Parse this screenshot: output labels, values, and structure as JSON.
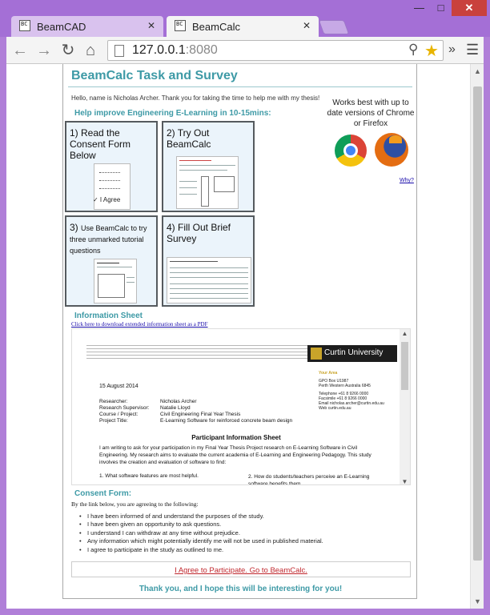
{
  "browser": {
    "tabs": [
      {
        "label": "BeamCAD",
        "favicon": "BC"
      },
      {
        "label": "BeamCalc",
        "favicon": "BC"
      }
    ],
    "url_host": "127.0.0.1",
    "url_port": ":8080"
  },
  "page": {
    "title": "BeamCalc Task and Survey",
    "greeting": "Hello, name is Nicholas Archer. Thank you for taking the time to help me with my thesis!",
    "help_heading": "Help improve Engineering E-Learning in 10-15mins:",
    "steps": [
      {
        "title": "1) Read the Consent Form Below",
        "thumb_text": "✓ I Agree"
      },
      {
        "title": "2) Try Out BeamCalc"
      },
      {
        "title_num": "3)",
        "title_rest": "Use BeamCalc to try three unmarked tutorial questions"
      },
      {
        "title": "4) Fill Out Brief Survey"
      }
    ],
    "browser_note": "Works best with up to date versions of Chrome or Firefox",
    "why_link": "Why?",
    "info_heading": "Information Sheet",
    "pdf_link": "Click here to download extended information sheet as a PDF",
    "pdf": {
      "university": "Curtin University",
      "date": "15 August 2014",
      "address": {
        "your_area": "Your Area",
        "box": "GPO Box U1987",
        "city": "Perth Western Australia 6845",
        "telephone": "Telephone +61 8 9266 0000",
        "facsimile": "Facsimile +61 8 9266 0000",
        "email": "Email nicholas.archer@curtin.edu.au",
        "web": "Web curtin.edu.au"
      },
      "fields": [
        {
          "key": "Researcher:",
          "value": "Nicholas Archer"
        },
        {
          "key": "Research Supervisor:",
          "value": "Natalie Lloyd"
        },
        {
          "key": "Course / Project:",
          "value": "Civil Engineering Final Year Thesis"
        },
        {
          "key": "Project Title:",
          "value": "E-Learning Software for reinforced concrete beam design"
        }
      ],
      "sheet_title": "Participant Information Sheet",
      "body": "I am writing to ask for your participation in my Final Year Thesis Project research on E-Learning Software in Civil Engineering.  My research aims to evaluate the current academia of E-Learning and Engineering Pedagogy. This study involves the creation and evaluation of software to find:",
      "q1": "1.      What software features are most helpful.",
      "q2": "2.      How do students/teachers perceive an E-Learning software benefits them."
    },
    "consent_heading": "Consent Form:",
    "consent_intro": "By the link below, you are agreeing to the following:",
    "consent_items": [
      "I have been informed of and understand the purposes of the study.",
      "I have been given an opportunity to ask questions.",
      "I understand I can withdraw at any time without prejudice.",
      "Any information which might potentially identify me will not be used in published material.",
      "I agree to participate in the study as outlined to me."
    ],
    "agree_link": "I Agree to Participate. Go to BeamCalc.",
    "thanks": "Thank you, and I hope this will be interesting for you!"
  }
}
